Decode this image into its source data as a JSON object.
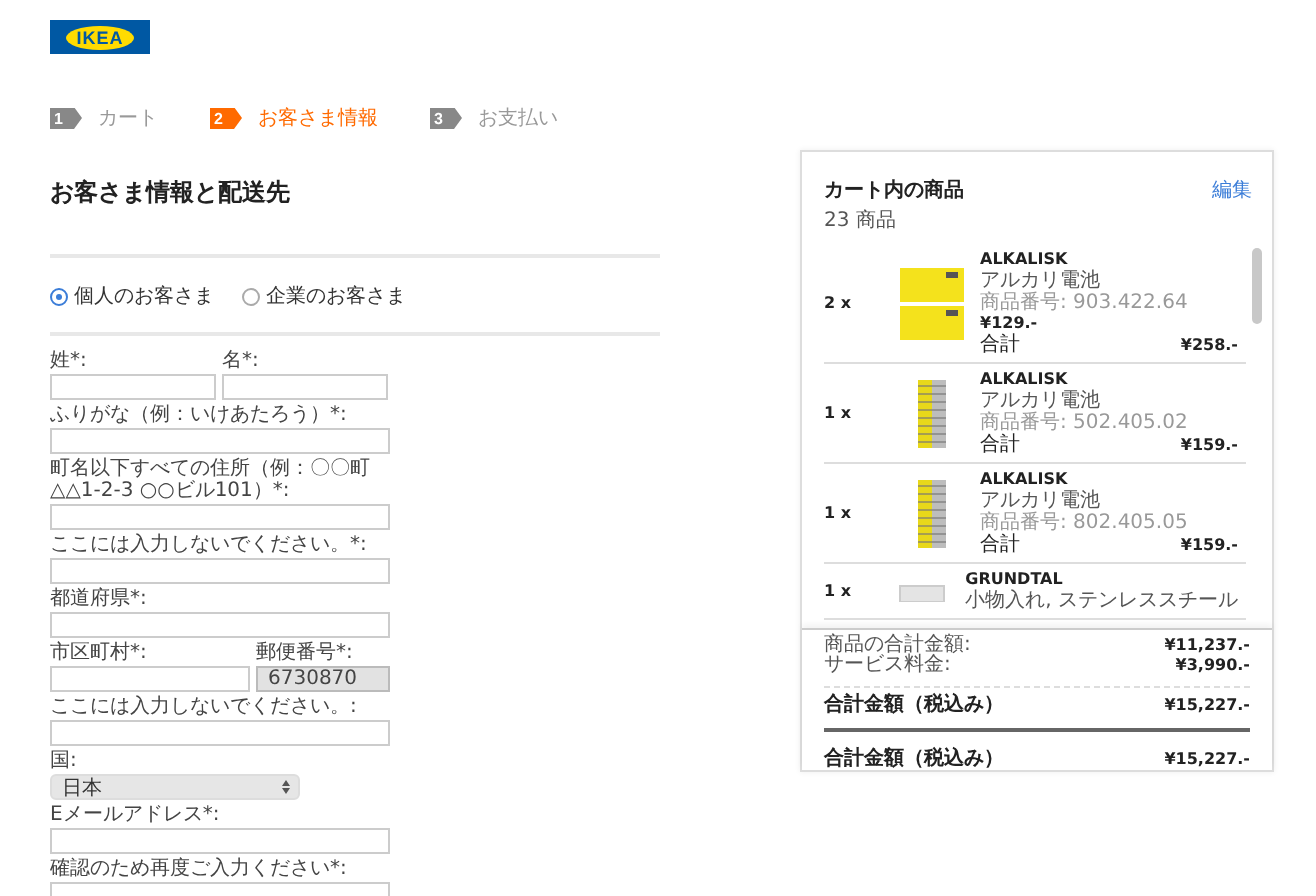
{
  "logo": "IKEA",
  "steps": [
    {
      "number": "1",
      "label": "カート",
      "selected": false
    },
    {
      "number": "2",
      "label": "お客さま情報",
      "selected": true
    },
    {
      "number": "3",
      "label": "お支払い",
      "selected": false
    }
  ],
  "heading": "お客さま情報と配送先",
  "customer_types": [
    {
      "label": "個人のお客さま",
      "selected": true
    },
    {
      "label": "企業のお客さま",
      "selected": false
    }
  ],
  "form_rows": [
    {
      "fields": [
        {
          "kind": "text",
          "label": "姓*:",
          "disabled": false
        },
        {
          "kind": "text",
          "label": "名*:",
          "disabled": false
        }
      ]
    },
    {
      "fields": [
        {
          "kind": "text",
          "label": "ふりがな（例：いけあたろう）*:",
          "disabled": false
        }
      ]
    },
    {
      "fields": [
        {
          "kind": "text",
          "label": "町名以下すべての住所（例：〇〇町△△1-2-3 ○○ビル101）*:",
          "disabled": false
        }
      ]
    },
    {
      "fields": [
        {
          "kind": "text",
          "label": "ここには入力しないでください。*:",
          "disabled": false
        }
      ]
    },
    {
      "fields": [
        {
          "kind": "text",
          "label": "都道府県*:",
          "disabled": false
        }
      ]
    },
    {
      "fields": [
        {
          "kind": "text",
          "label": "市区町村*:",
          "disabled": false
        },
        {
          "kind": "text",
          "label": "郵便番号*:",
          "value": "6730870",
          "disabled": true
        }
      ]
    },
    {
      "fields": [
        {
          "kind": "text",
          "label": "ここには入力しないでください。:",
          "disabled": false
        }
      ]
    },
    {
      "fields": [
        {
          "kind": "select",
          "label": "国:",
          "value": "日本"
        }
      ]
    },
    {
      "fields": [
        {
          "kind": "text",
          "label": "Eメールアドレス*:",
          "disabled": false
        }
      ]
    },
    {
      "fields": [
        {
          "kind": "text",
          "label": "確認のため再度ご入力ください*:",
          "disabled": false
        }
      ]
    }
  ],
  "cart": {
    "title": "カート内の商品",
    "count": "23 商品",
    "edit_link": "編集",
    "items": [
      {
        "quantity": "2 x",
        "name": "ALKALISK",
        "description": "アルカリ電池",
        "article": "商品番号: 903.422.64",
        "price": "¥129.-",
        "total_label": "合計",
        "total": "¥258.-"
      },
      {
        "quantity": "1 x",
        "name": "ALKALISK",
        "description": "アルカリ電池",
        "article": "商品番号: 502.405.02",
        "total_label": "合計",
        "total": "¥159.-"
      },
      {
        "quantity": "1 x",
        "name": "ALKALISK",
        "description": "アルカリ電池",
        "article": "商品番号: 802.405.05",
        "total_label": "合計",
        "total": "¥159.-"
      },
      {
        "quantity": "1 x",
        "name": "GRUNDTAL",
        "description": "小物入れ, ステンレススチール"
      }
    ],
    "summary": [
      {
        "label": "商品の合計金額:",
        "value": "¥11,237.-"
      },
      {
        "label": "サービス料金:",
        "value": "¥3,990.-"
      }
    ],
    "total": {
      "label": "合計金額（税込み）",
      "value": "¥15,227.-"
    },
    "grand_total": {
      "label": "合計金額（税込み）",
      "value": "¥15,227.-"
    }
  }
}
